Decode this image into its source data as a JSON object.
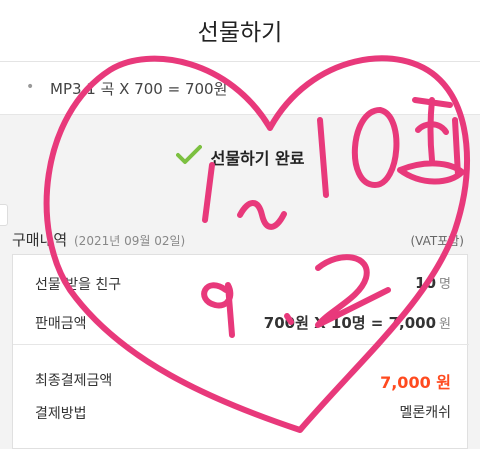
{
  "header": {
    "title": "선물하기"
  },
  "item": {
    "text": "MP3 1 곡 X 700 = 700원"
  },
  "status": {
    "done_text": "선물하기 완료"
  },
  "purchase": {
    "title": "구매내역",
    "date": "(2021년 09월 02일)",
    "vat_note": "(VAT포함)"
  },
  "details": {
    "recipient_label": "선물 받을 친구",
    "recipient_count": "10",
    "recipient_unit": "명",
    "price_label": "판매금액",
    "price_formula": "700원 X 10명 = 7,000",
    "price_unit": "원",
    "total_label": "최종결제금액",
    "total_value": "7,000 원",
    "method_label": "결제방법",
    "method_value": "멜론캐쉬"
  },
  "handwriting": {
    "line1": "1~10명",
    "line2": "9.2"
  },
  "colors": {
    "check": "#7cc040",
    "total": "#ff4a1f",
    "ink": "#e8397b"
  }
}
